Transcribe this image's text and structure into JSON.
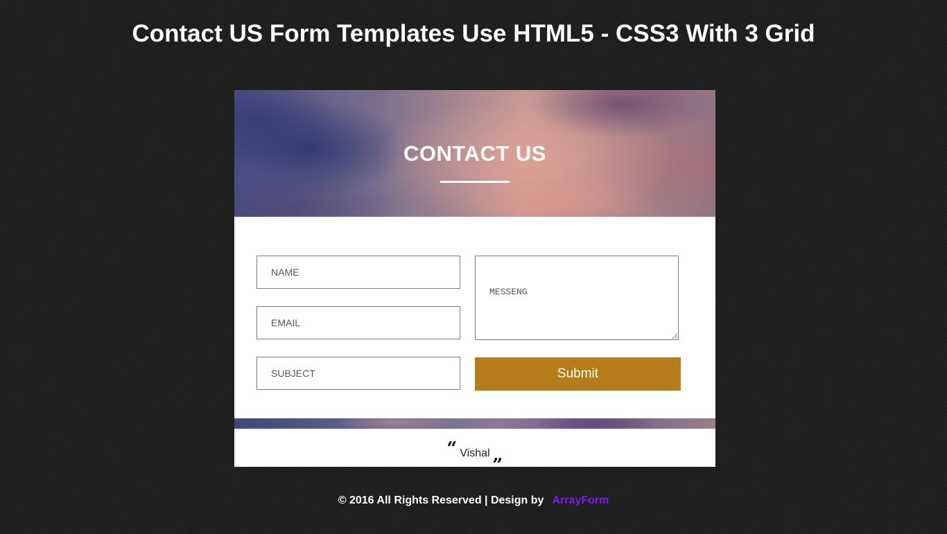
{
  "page": {
    "title": "Contact US Form Templates Use HTML5 - CSS3 With 3 Grid"
  },
  "card": {
    "heading": "CONTACT US",
    "form": {
      "name_placeholder": "NAME",
      "email_placeholder": "EMAIL",
      "subject_placeholder": "SUBJECT",
      "message_placeholder": "MESSENG",
      "submit_label": "Submit"
    },
    "credit": {
      "open_quote": "“",
      "name": "Vishal",
      "close_quote": "„"
    }
  },
  "footer": {
    "text": "© 2016 All Rights Reserved | Design by",
    "link_text": "ArrayForm"
  },
  "colors": {
    "background": "#1f1f1f",
    "accent_button": "#b47c1a",
    "footer_link": "#7a1df0"
  }
}
